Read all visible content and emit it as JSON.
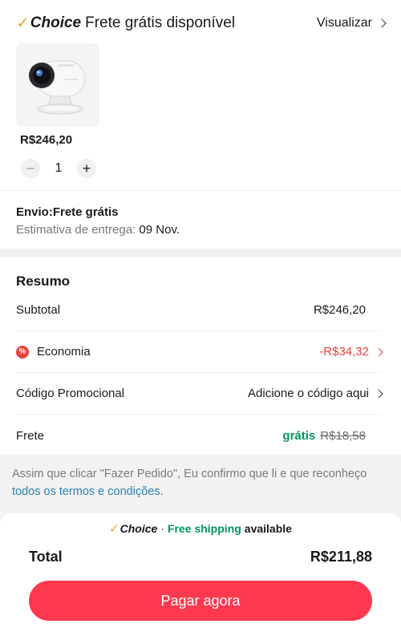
{
  "header": {
    "choice_check": "✓",
    "choice_word": "Choice",
    "title": "Frete grátis disponível",
    "view_label": "Visualizar"
  },
  "product": {
    "price": "R$246,20",
    "quantity": "1",
    "minus": "−",
    "plus": "+"
  },
  "shipping": {
    "title": "Envio:Frete grátis",
    "estimate_label": "Estimativa de entrega:",
    "estimate_date": "09 Nov."
  },
  "summary": {
    "title": "Resumo",
    "subtotal_label": "Subtotal",
    "subtotal_value": "R$246,20",
    "economy_label": "Economia",
    "economy_icon": "%",
    "economy_value": "-R$34,32",
    "promo_label": "Código Promocional",
    "promo_value": "Adicione o código aqui",
    "shipping_label": "Frete",
    "shipping_free": "grátis",
    "shipping_old": "R$18,58"
  },
  "terms": {
    "text": "Assim que clicar \"Fazer Pedido\", Eu confirmo que li e que reconheço",
    "link": "todos os termos e condições."
  },
  "footer": {
    "choice_check": "✓",
    "choice_word": "Choice",
    "dot": "·",
    "free_shipping": "Free shipping",
    "available": "available",
    "total_label": "Total",
    "total_value": "R$211,88",
    "pay_label": "Pagar agora"
  },
  "colors": {
    "accent_red": "#fd384f",
    "discount_red": "#e8413c",
    "free_green": "#00935a",
    "choice_gold": "#f5a623",
    "link_blue": "#2a7fb0"
  },
  "icons": [
    "choice-check-icon",
    "chevron-right-icon",
    "discount-icon",
    "product-image"
  ]
}
